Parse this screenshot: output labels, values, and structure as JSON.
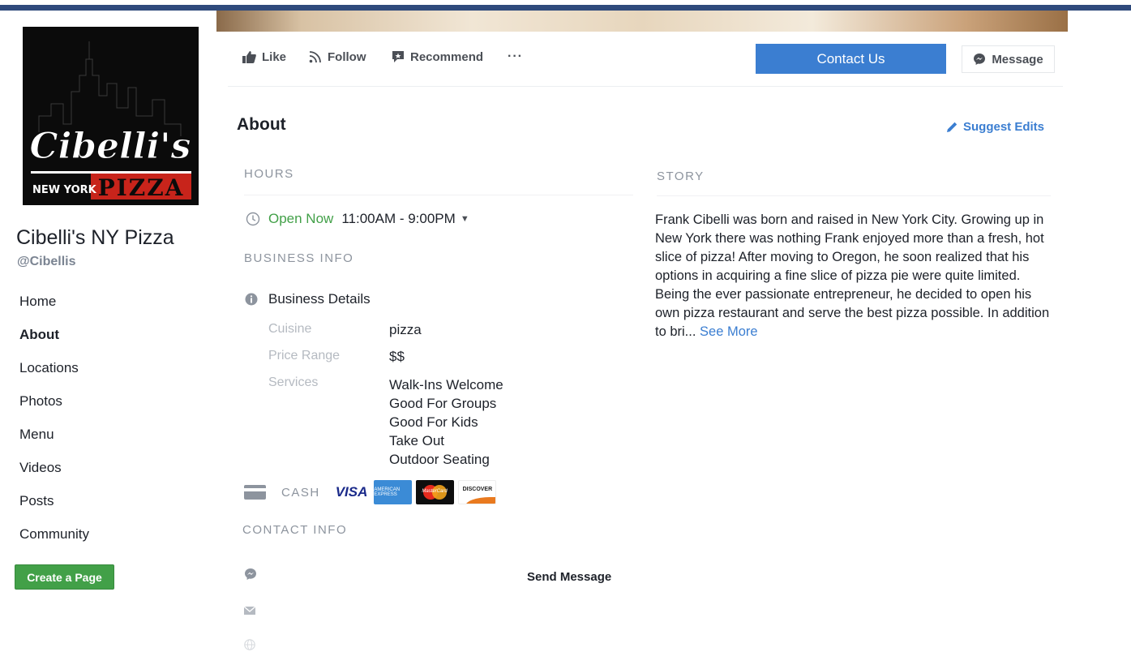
{
  "brand": {
    "logo_text_script": "Cibelli's",
    "logo_text_city": "NEW YORK",
    "logo_text_pizza": "PIZZA"
  },
  "page": {
    "name": "Cibelli's NY Pizza",
    "handle": "@Cibellis"
  },
  "sidebar": {
    "items": [
      {
        "label": "Home"
      },
      {
        "label": "About"
      },
      {
        "label": "Locations"
      },
      {
        "label": "Photos"
      },
      {
        "label": "Menu"
      },
      {
        "label": "Videos"
      },
      {
        "label": "Posts"
      },
      {
        "label": "Community"
      }
    ],
    "active": "About",
    "create_page_label": "Create a Page"
  },
  "actions": {
    "like": "Like",
    "follow": "Follow",
    "recommend": "Recommend",
    "more": "···",
    "contact_us": "Contact Us",
    "message": "Message"
  },
  "about": {
    "title": "About",
    "suggest_edits": "Suggest Edits"
  },
  "hours": {
    "heading": "HOURS",
    "status": "Open Now",
    "range": "11:00AM - 9:00PM"
  },
  "business_info": {
    "heading": "BUSINESS INFO",
    "details_label": "Business Details",
    "cuisine_label": "Cuisine",
    "cuisine_value": "pizza",
    "price_label": "Price Range",
    "price_value": "$$",
    "services_label": "Services",
    "services": [
      "Walk-Ins Welcome",
      "Good For Groups",
      "Good For Kids",
      "Take Out",
      "Outdoor Seating"
    ]
  },
  "payment": {
    "cash": "CASH",
    "visa": "VISA",
    "amex": "AMERICAN EXPRESS",
    "mastercard": "MasterCard",
    "discover": "DISCOVER"
  },
  "contact": {
    "heading": "CONTACT INFO",
    "send_message": "Send Message"
  },
  "story": {
    "heading": "STORY",
    "text": "Frank Cibelli was born and raised in New York City. Growing up in New York there was nothing Frank enjoyed more than a fresh, hot slice of pizza! After moving to Oregon, he soon realized that his options in acquiring a fine slice of pizza pie were quite limited. Being the ever passionate entrepreneur, he decided to open his own pizza restaurant and serve the best pizza possible. In addition to bri...",
    "see_more": "See More"
  },
  "colors": {
    "accent_blue": "#3b7ed1",
    "open_green": "#42a048",
    "header_navy": "#2f4a7c",
    "logo_red": "#c8241b"
  }
}
